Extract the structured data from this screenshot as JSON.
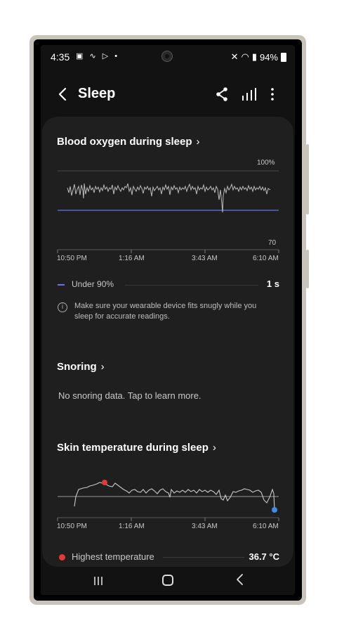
{
  "status_bar": {
    "time": "4:35",
    "battery": "94%"
  },
  "app_bar": {
    "title": "Sleep",
    "back_icon": "arrow-left-icon",
    "share_icon": "share-icon",
    "stats_icon": "bar-chart-icon",
    "more_icon": "more-vertical-icon"
  },
  "blood_oxygen": {
    "title": "Blood oxygen during sleep",
    "y_top": "100%",
    "y_bottom": "70",
    "x_ticks": [
      "10:50 PM",
      "1:16 AM",
      "3:43 AM",
      "6:10 AM"
    ],
    "legend_label": "Under 90%",
    "legend_value": "1 s",
    "info_text": "Make sure your wearable device fits snugly while you sleep for accurate readings."
  },
  "snoring": {
    "title": "Snoring",
    "text": "No snoring data. Tap to learn more."
  },
  "skin_temp": {
    "title": "Skin temperature during sleep",
    "x_ticks": [
      "10:50 PM",
      "1:16 AM",
      "3:43 AM",
      "6:10 AM"
    ],
    "highest_label": "Highest temperature",
    "highest_value": "36.7 °C"
  },
  "colors": {
    "accent_blue": "#6a75d8",
    "high_red": "#e53935",
    "low_blue": "#3b8ef0"
  }
}
